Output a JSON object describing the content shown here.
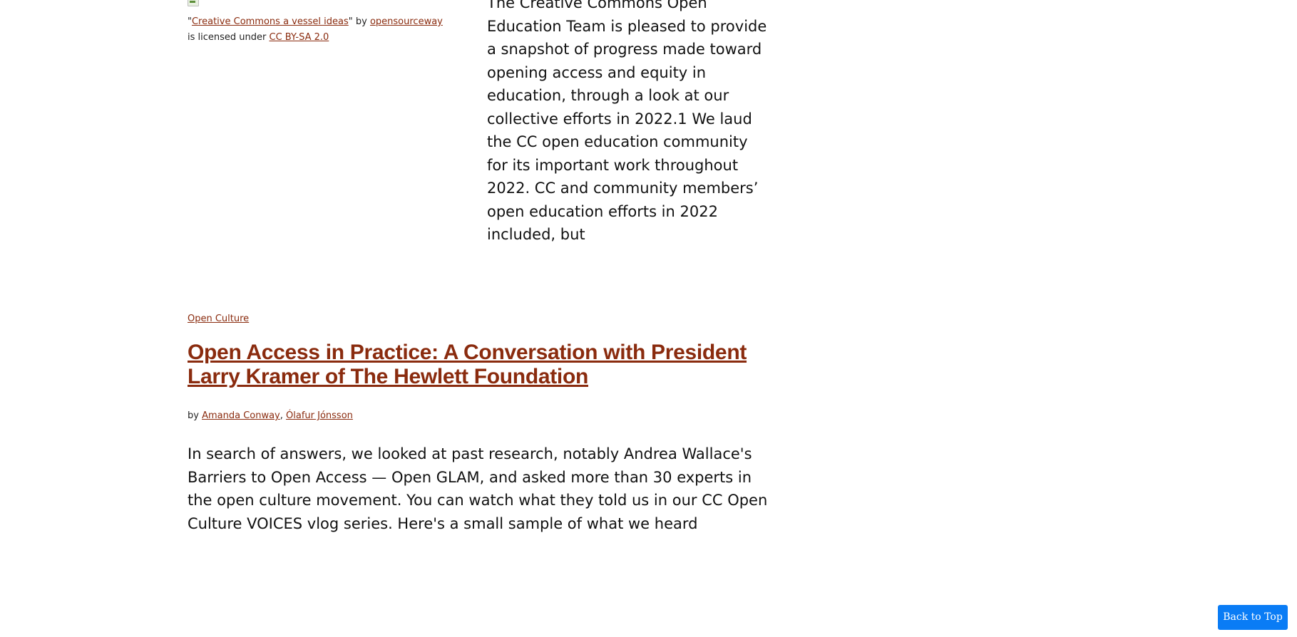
{
  "image_caption": {
    "quote_open": "\"",
    "title_link": "Creative Commons a vessel ideas",
    "quote_close_by": "\" by ",
    "author_link": "opensourceway",
    "license_prefix": " is licensed under ",
    "license_link": "CC BY-SA 2.0"
  },
  "top_excerpt": "The Creative Commons Open Education Team is pleased to provide a snapshot of progress made toward opening access and equity in education, through a look at our collective efforts in 2022.1 We laud the CC open education community for its important work throughout 2022. CC and community members’ open education efforts in 2022 included, but",
  "post": {
    "category": "Open Culture",
    "title": "Open Access in Practice: A Conversation with President Larry Kramer of The Hewlett Foundation",
    "by_label": "by ",
    "authors": [
      "Amanda Conway",
      "Ólafur Jónsson"
    ],
    "author_separator": ", ",
    "excerpt": "In search of answers, we looked at past research, notably Andrea Wallace's Barriers to Open Access — Open GLAM, and asked more than 30 experts in the open culture movement. You can watch what they told us in our CC Open Culture VOICES vlog series. Here's a small sample of what we heard"
  },
  "back_to_top_label": "Back to Top",
  "colors": {
    "link": "#8a2b0e",
    "button_bg": "#0a7cf5",
    "button_text": "#ffffff"
  }
}
